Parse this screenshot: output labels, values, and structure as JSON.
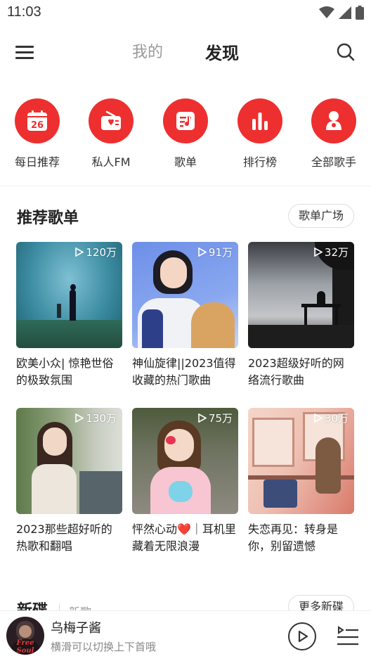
{
  "status": {
    "time": "11:03"
  },
  "header": {
    "tabs": [
      "我的",
      "发现"
    ],
    "active_tab": "发现",
    "accent_color": "#ee2f2f"
  },
  "quick_nav": [
    {
      "label": "每日推荐",
      "icon": "calendar-icon",
      "badge": "26"
    },
    {
      "label": "私人FM",
      "icon": "radio-icon"
    },
    {
      "label": "歌单",
      "icon": "playlist-icon"
    },
    {
      "label": "排行榜",
      "icon": "chart-icon"
    },
    {
      "label": "全部歌手",
      "icon": "singer-icon"
    }
  ],
  "recommended": {
    "title": "推荐歌单",
    "more_label": "歌单广场",
    "playlists": [
      {
        "plays": "120万",
        "title": "欧美小众| 惊艳世俗的极致氛围"
      },
      {
        "plays": "91万",
        "title": "神仙旋律||2023值得收藏的热门歌曲"
      },
      {
        "plays": "32万",
        "title": "2023超级好听的网络流行歌曲"
      },
      {
        "plays": "130万",
        "title": "2023那些超好听的热歌和翻唱"
      },
      {
        "plays": "75万",
        "title": "怦然心动❤️｜耳机里藏着无限浪漫"
      },
      {
        "plays": "30万",
        "title": "失恋再见：转身是你，别留遗憾"
      }
    ]
  },
  "new_discs": {
    "title": "新碟",
    "tab": "新歌",
    "more_label": "更多新碟"
  },
  "player": {
    "title": "乌梅子酱",
    "subtitle": "横滑可以切换上下首哦",
    "cover_text": "Free Soul"
  }
}
